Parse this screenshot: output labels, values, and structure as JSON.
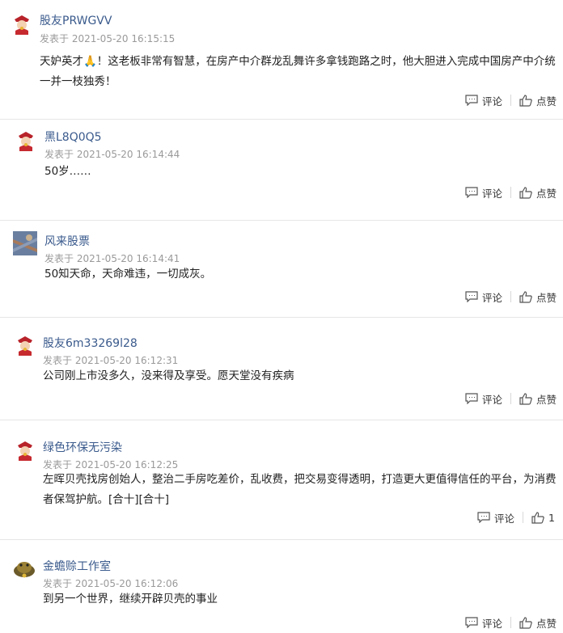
{
  "comments": [
    {
      "user": "股友PRWGVV",
      "time": "发表于 2021-05-20 16:15:15",
      "text": "天妒英才🙏！这老板非常有智慧，在房产中介群龙乱舞许多拿钱跑路之时，他大胆进入完成中国房产中介统一并一枝独秀！",
      "comment_label": "评论",
      "like_label": "点赞",
      "avatar": "god-of-wealth-avatar"
    },
    {
      "user": "黑L8Q0Q5",
      "time": "发表于 2021-05-20 16:14:44",
      "text": "50岁……",
      "comment_label": "评论",
      "like_label": "点赞",
      "avatar": "god-of-wealth-avatar"
    },
    {
      "user": "风来股票",
      "time": "发表于 2021-05-20 16:14:41",
      "text": "50知天命，天命难违，一切成灰。",
      "comment_label": "评论",
      "like_label": "点赞",
      "avatar": "landscape-photo-avatar"
    },
    {
      "user": "股友6m33269l28",
      "time": "发表于 2021-05-20 16:12:31",
      "text": "公司刚上市没多久，没来得及享受。愿天堂没有疾病",
      "comment_label": "评论",
      "like_label": "点赞",
      "avatar": "god-of-wealth-avatar"
    },
    {
      "user": "绿色环保无污染",
      "time": "发表于 2021-05-20 16:12:25",
      "text": "左晖贝壳找房创始人，整治二手房吃差价，乱收费，把交易变得透明，打造更大更值得信任的平台，为消费者保驾护航。[合十][合十]",
      "comment_label": "评论",
      "like_label": "1",
      "avatar": "god-of-wealth-avatar"
    },
    {
      "user": "金蟾赊工作室",
      "time": "发表于 2021-05-20 16:12:06",
      "text": "到另一个世界，继续开辟贝壳的事业",
      "comment_label": "评论",
      "like_label": "点赞",
      "avatar": "golden-toad-avatar"
    }
  ]
}
